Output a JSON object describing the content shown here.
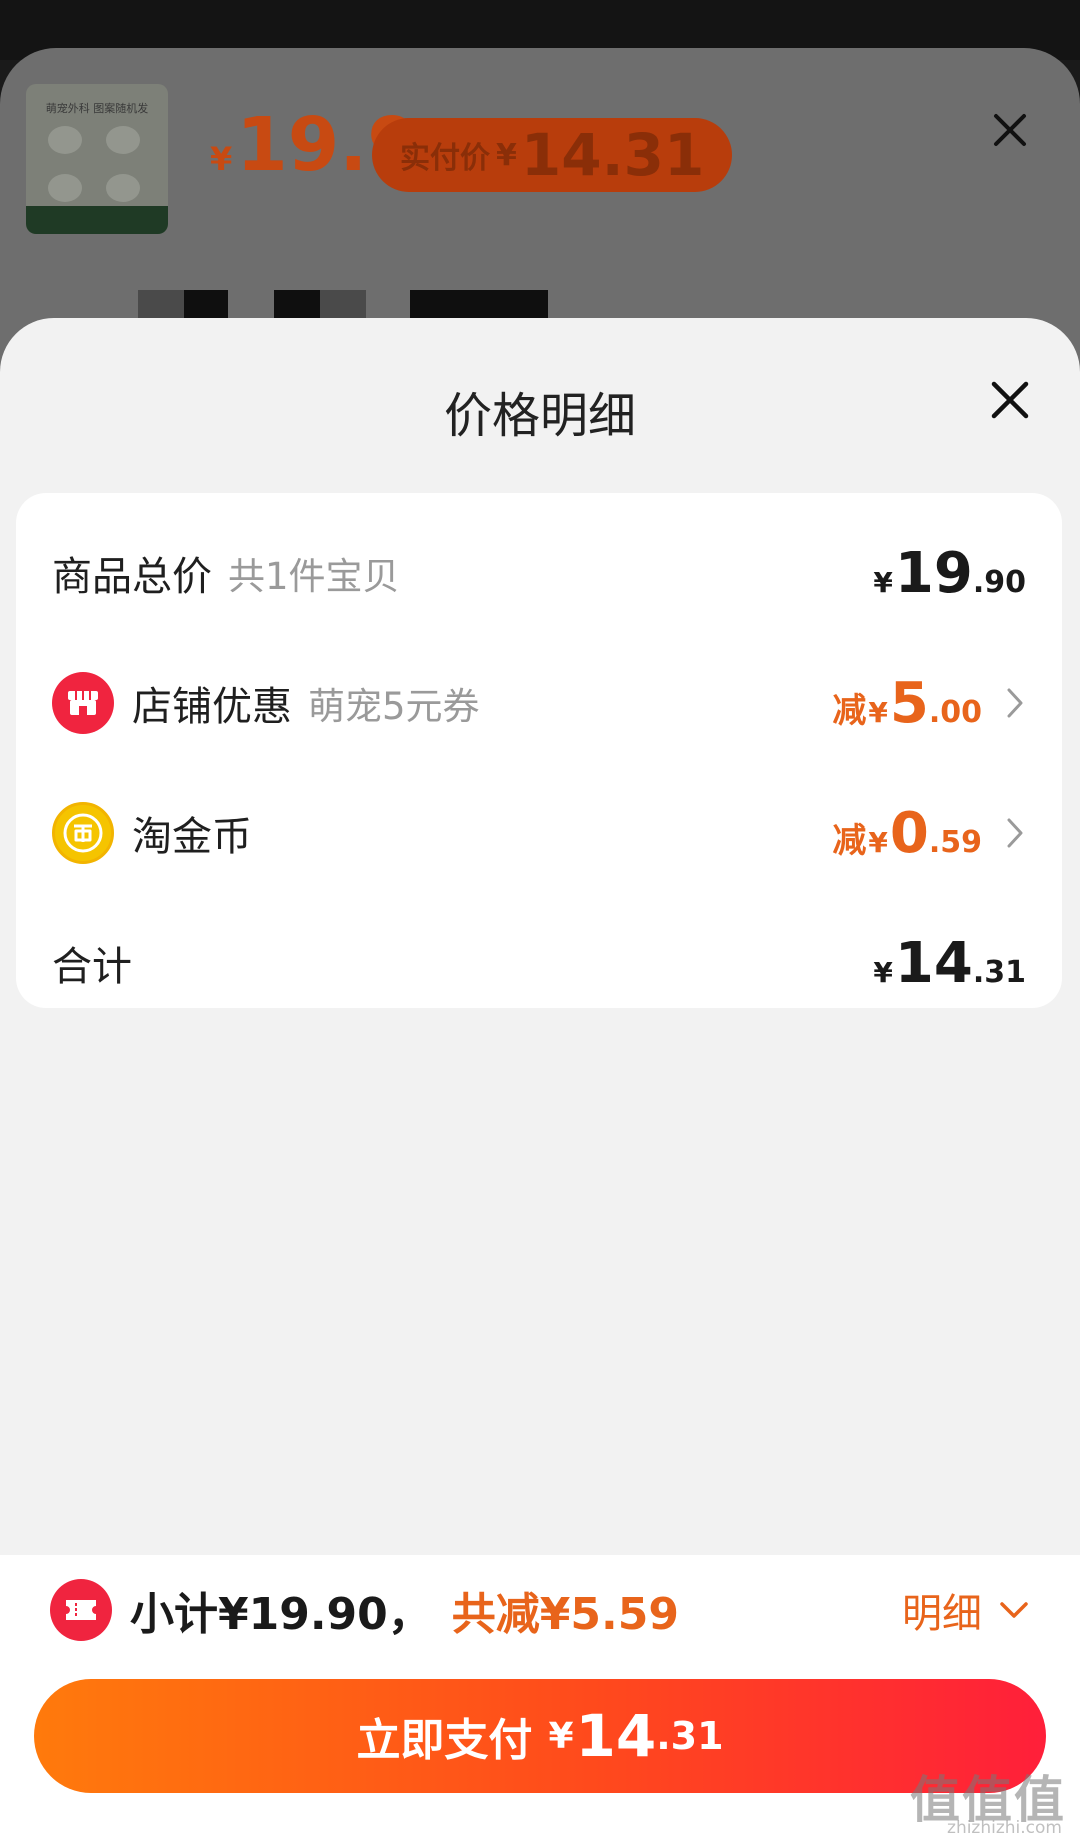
{
  "background": {
    "thumb_caption": "萌宠外科 图案随机发",
    "price": {
      "yen": "¥",
      "value": "19.9"
    },
    "pill": {
      "label": "实付价",
      "yen": "¥",
      "value": "14.31"
    }
  },
  "sheet": {
    "title": "价格明细"
  },
  "rows": {
    "total": {
      "label": "商品总价",
      "sub": "共1件宝贝",
      "yen": "¥",
      "int": "19",
      "dec": ".90"
    },
    "shop": {
      "label": "店铺优惠",
      "sub": "萌宠5元券",
      "prefix": "减",
      "yen": "¥",
      "int": "5",
      "dec": ".00",
      "icon": "shop-icon"
    },
    "coin": {
      "label": "淘金币",
      "prefix": "减",
      "yen": "¥",
      "int": "0",
      "dec": ".59",
      "icon": "coin-icon"
    },
    "sum": {
      "label": "合计",
      "yen": "¥",
      "int": "14",
      "dec": ".31"
    }
  },
  "footer": {
    "subtotal": "小计¥19.90，",
    "reduced": "共减¥5.59",
    "detail_label": "明细",
    "pay": {
      "label": "立即支付",
      "yen": "¥",
      "int": "14",
      "dec": ".31"
    }
  },
  "watermark": {
    "main": "值值值",
    "sub": "zhizhizhi.com"
  },
  "colors": {
    "accent": "#e8641b",
    "brand_red": "#f0243f",
    "button_start": "#ff7a0c",
    "button_end": "#ff1f3a"
  }
}
